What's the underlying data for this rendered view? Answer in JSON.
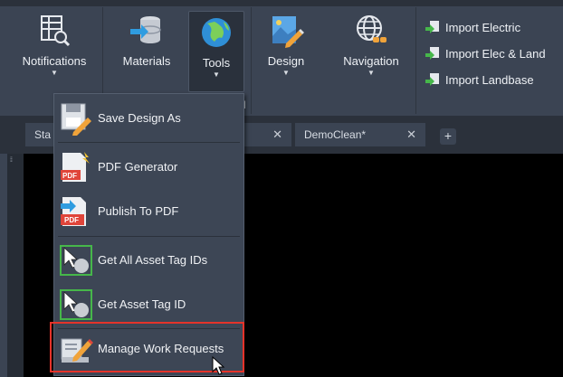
{
  "ribbon": {
    "notifications": "Notifications",
    "materials": "Materials",
    "tools": "Tools",
    "design": "Design",
    "navigation": "Navigation",
    "import_electric": "Import Electric",
    "import_elec_land": "Import Elec & Land",
    "import_landbase": "Import Landbase",
    "panel_partial_label": "M"
  },
  "tabs": [
    {
      "label": "Sta"
    },
    {
      "label": ""
    },
    {
      "label": "DemoClean*"
    }
  ],
  "menu": {
    "items": [
      {
        "label": "Save Design As",
        "icon": "save-design-icon"
      },
      {
        "label": "PDF Generator",
        "icon": "pdf-generator-icon"
      },
      {
        "label": "Publish To PDF",
        "icon": "publish-pdf-icon"
      },
      {
        "label": "Get All Asset Tag IDs",
        "icon": "asset-tag-all-icon"
      },
      {
        "label": "Get Asset Tag ID",
        "icon": "asset-tag-icon"
      },
      {
        "label": "Manage Work Requests",
        "icon": "work-request-icon"
      }
    ]
  },
  "colors": {
    "ribbon_bg": "#3b4453",
    "highlight_border": "#e5332a",
    "canvas_bg": "#000000"
  }
}
